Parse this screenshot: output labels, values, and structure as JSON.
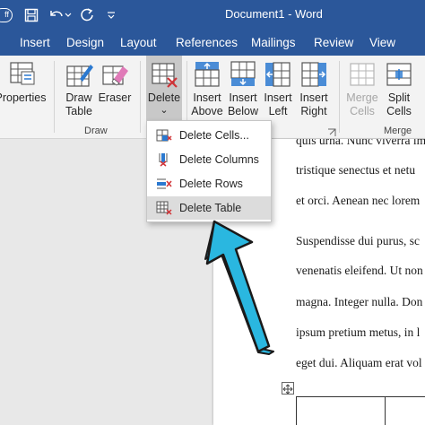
{
  "titlebar": {
    "autosave_label": "ff",
    "title": "Document1 - Word"
  },
  "tabs": [
    "Insert",
    "Design",
    "Layout",
    "References",
    "Mailings",
    "Review",
    "View"
  ],
  "ribbon": {
    "properties_label": "Properties",
    "draw_table_label": "Draw\nTable",
    "eraser_label": "Eraser",
    "draw_group_label": "Draw",
    "delete_label": "Delete",
    "delete_caret": "⌄",
    "insert_above_label": "Insert\nAbove",
    "insert_below_label": "Insert\nBelow",
    "insert_left_label": "Insert\nLeft",
    "insert_right_label": "Insert\nRight",
    "merge_cells_label": "Merge\nCells",
    "split_cells_label": "Split\nCells",
    "merge_group_label": "Merge"
  },
  "menu": {
    "items": [
      {
        "label": "Delete Cells...",
        "icon": "delete-cells-icon"
      },
      {
        "label": "Delete Columns",
        "icon": "delete-columns-icon"
      },
      {
        "label": "Delete Rows",
        "icon": "delete-rows-icon"
      },
      {
        "label": "Delete Table",
        "icon": "delete-table-icon"
      }
    ]
  },
  "document": {
    "lines": [
      "quis urna. Nunc viverra im",
      "tristique senectus et netu",
      "et orci. Aenean nec lorem",
      "Suspendisse dui purus, sc",
      "venenatis eleifend. Ut non",
      "magna. Integer nulla. Don",
      "ipsum pretium metus, in l",
      "eget dui. Aliquam erat vol"
    ]
  },
  "colors": {
    "title_bar": "#2b579a",
    "arrow": "#2ab7e0",
    "icon_red": "#d13438",
    "icon_blue": "#2b79d0"
  }
}
